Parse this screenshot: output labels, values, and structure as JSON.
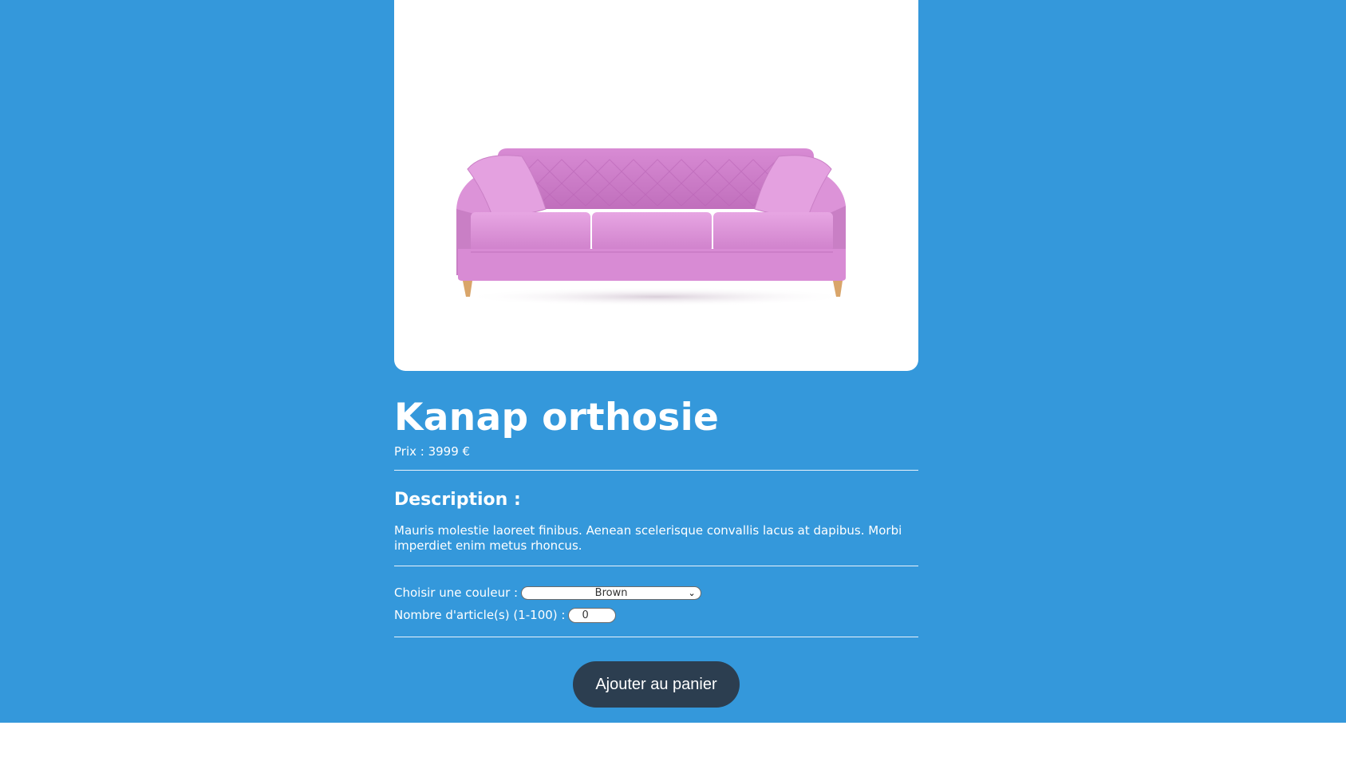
{
  "product": {
    "image_alt": "pink tufted sofa",
    "title": "Kanap orthosie",
    "price_label": "Prix : ",
    "price_value": "3999",
    "currency": " €",
    "description_title": "Description :",
    "description_text": "Mauris molestie laoreet finibus. Aenean scelerisque convallis lacus at dapibus. Morbi imperdiet enim metus rhoncus."
  },
  "options": {
    "color_label": "Choisir une couleur : ",
    "color_selected": "Brown",
    "quantity_label": "Nombre d'article(s) (1-100) : ",
    "quantity_value": "0"
  },
  "cart": {
    "add_label": "Ajouter au panier"
  },
  "colors": {
    "background": "#3498db",
    "button": "#2c3e50",
    "sofa": "#d98ed6"
  }
}
